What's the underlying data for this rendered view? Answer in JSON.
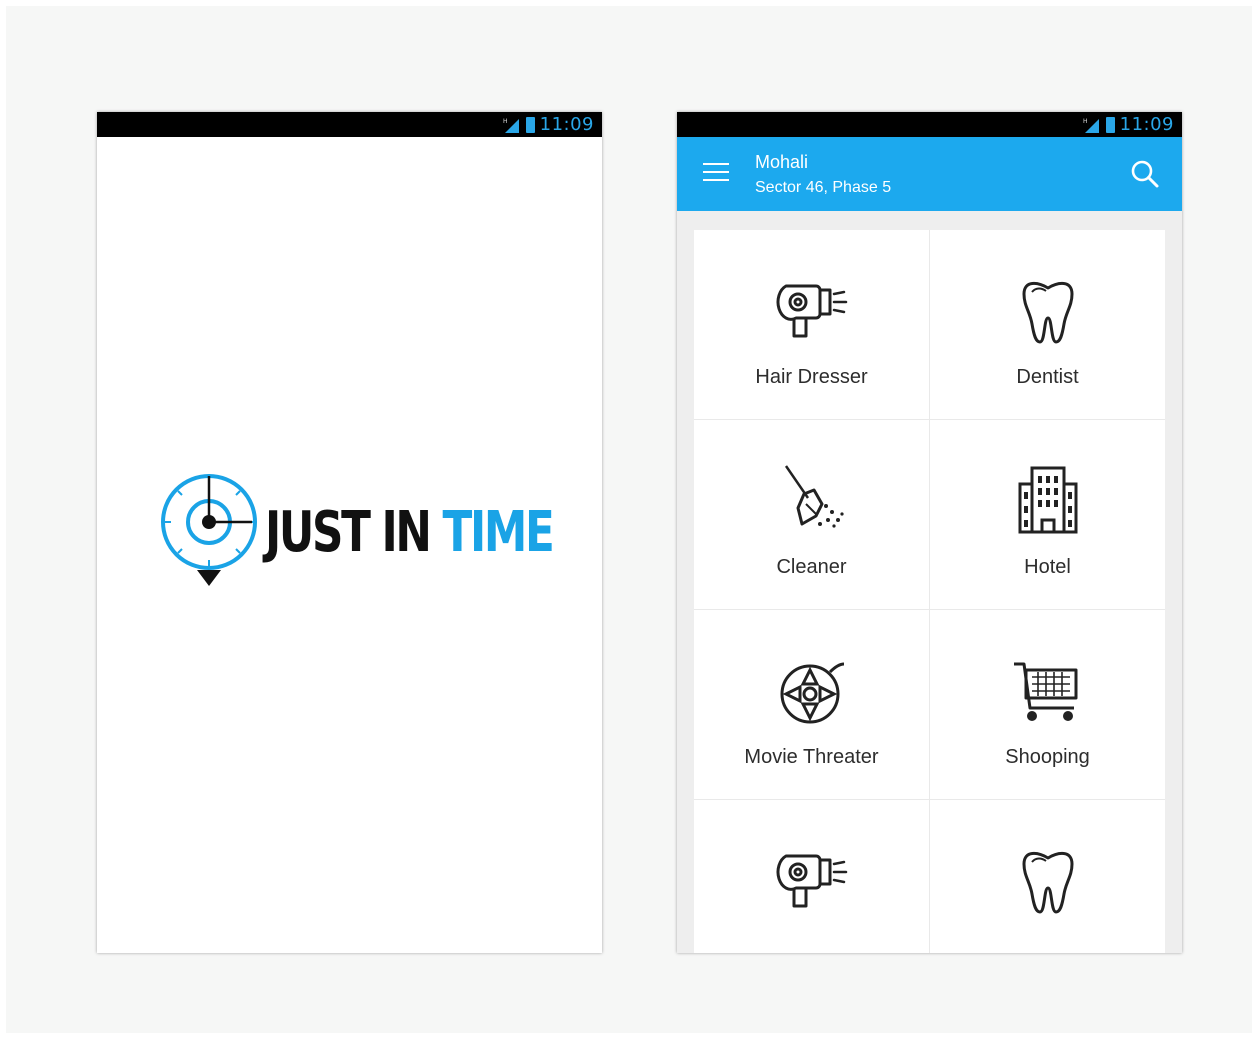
{
  "splash": {
    "status_time": "11:09",
    "logo_word1": "JUST IN",
    "logo_word2": "TIME"
  },
  "home": {
    "status_time": "11:09",
    "location_city": "Mohali",
    "location_area": "Sector 46, Phase 5",
    "categories": [
      {
        "label": "Hair Dresser",
        "icon": "hair-dryer-icon"
      },
      {
        "label": "Dentist",
        "icon": "tooth-icon"
      },
      {
        "label": "Cleaner",
        "icon": "broom-icon"
      },
      {
        "label": "Hotel",
        "icon": "hotel-building-icon"
      },
      {
        "label": "Movie Threater",
        "icon": "film-reel-icon"
      },
      {
        "label": "Shooping",
        "icon": "shopping-cart-icon"
      },
      {
        "label": "",
        "icon": "hair-dryer-icon"
      },
      {
        "label": "",
        "icon": "tooth-icon"
      }
    ]
  },
  "colors": {
    "accent": "#1ca9ee",
    "status_bar": "#000000",
    "logo_dark": "#111111",
    "logo_blue": "#1aa3e6"
  }
}
